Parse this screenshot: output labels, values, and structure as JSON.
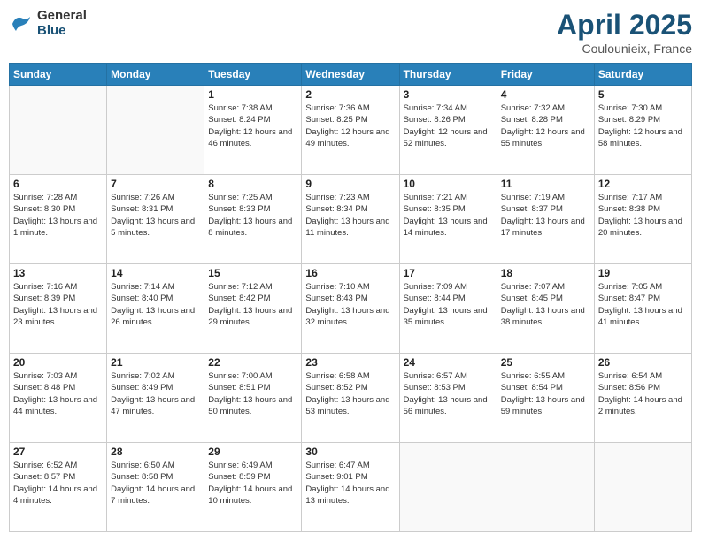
{
  "header": {
    "logo_general": "General",
    "logo_blue": "Blue",
    "title": "April 2025",
    "location": "Coulounieix, France"
  },
  "days_of_week": [
    "Sunday",
    "Monday",
    "Tuesday",
    "Wednesday",
    "Thursday",
    "Friday",
    "Saturday"
  ],
  "weeks": [
    [
      {
        "num": "",
        "info": ""
      },
      {
        "num": "",
        "info": ""
      },
      {
        "num": "1",
        "info": "Sunrise: 7:38 AM\nSunset: 8:24 PM\nDaylight: 12 hours and 46 minutes."
      },
      {
        "num": "2",
        "info": "Sunrise: 7:36 AM\nSunset: 8:25 PM\nDaylight: 12 hours and 49 minutes."
      },
      {
        "num": "3",
        "info": "Sunrise: 7:34 AM\nSunset: 8:26 PM\nDaylight: 12 hours and 52 minutes."
      },
      {
        "num": "4",
        "info": "Sunrise: 7:32 AM\nSunset: 8:28 PM\nDaylight: 12 hours and 55 minutes."
      },
      {
        "num": "5",
        "info": "Sunrise: 7:30 AM\nSunset: 8:29 PM\nDaylight: 12 hours and 58 minutes."
      }
    ],
    [
      {
        "num": "6",
        "info": "Sunrise: 7:28 AM\nSunset: 8:30 PM\nDaylight: 13 hours and 1 minute."
      },
      {
        "num": "7",
        "info": "Sunrise: 7:26 AM\nSunset: 8:31 PM\nDaylight: 13 hours and 5 minutes."
      },
      {
        "num": "8",
        "info": "Sunrise: 7:25 AM\nSunset: 8:33 PM\nDaylight: 13 hours and 8 minutes."
      },
      {
        "num": "9",
        "info": "Sunrise: 7:23 AM\nSunset: 8:34 PM\nDaylight: 13 hours and 11 minutes."
      },
      {
        "num": "10",
        "info": "Sunrise: 7:21 AM\nSunset: 8:35 PM\nDaylight: 13 hours and 14 minutes."
      },
      {
        "num": "11",
        "info": "Sunrise: 7:19 AM\nSunset: 8:37 PM\nDaylight: 13 hours and 17 minutes."
      },
      {
        "num": "12",
        "info": "Sunrise: 7:17 AM\nSunset: 8:38 PM\nDaylight: 13 hours and 20 minutes."
      }
    ],
    [
      {
        "num": "13",
        "info": "Sunrise: 7:16 AM\nSunset: 8:39 PM\nDaylight: 13 hours and 23 minutes."
      },
      {
        "num": "14",
        "info": "Sunrise: 7:14 AM\nSunset: 8:40 PM\nDaylight: 13 hours and 26 minutes."
      },
      {
        "num": "15",
        "info": "Sunrise: 7:12 AM\nSunset: 8:42 PM\nDaylight: 13 hours and 29 minutes."
      },
      {
        "num": "16",
        "info": "Sunrise: 7:10 AM\nSunset: 8:43 PM\nDaylight: 13 hours and 32 minutes."
      },
      {
        "num": "17",
        "info": "Sunrise: 7:09 AM\nSunset: 8:44 PM\nDaylight: 13 hours and 35 minutes."
      },
      {
        "num": "18",
        "info": "Sunrise: 7:07 AM\nSunset: 8:45 PM\nDaylight: 13 hours and 38 minutes."
      },
      {
        "num": "19",
        "info": "Sunrise: 7:05 AM\nSunset: 8:47 PM\nDaylight: 13 hours and 41 minutes."
      }
    ],
    [
      {
        "num": "20",
        "info": "Sunrise: 7:03 AM\nSunset: 8:48 PM\nDaylight: 13 hours and 44 minutes."
      },
      {
        "num": "21",
        "info": "Sunrise: 7:02 AM\nSunset: 8:49 PM\nDaylight: 13 hours and 47 minutes."
      },
      {
        "num": "22",
        "info": "Sunrise: 7:00 AM\nSunset: 8:51 PM\nDaylight: 13 hours and 50 minutes."
      },
      {
        "num": "23",
        "info": "Sunrise: 6:58 AM\nSunset: 8:52 PM\nDaylight: 13 hours and 53 minutes."
      },
      {
        "num": "24",
        "info": "Sunrise: 6:57 AM\nSunset: 8:53 PM\nDaylight: 13 hours and 56 minutes."
      },
      {
        "num": "25",
        "info": "Sunrise: 6:55 AM\nSunset: 8:54 PM\nDaylight: 13 hours and 59 minutes."
      },
      {
        "num": "26",
        "info": "Sunrise: 6:54 AM\nSunset: 8:56 PM\nDaylight: 14 hours and 2 minutes."
      }
    ],
    [
      {
        "num": "27",
        "info": "Sunrise: 6:52 AM\nSunset: 8:57 PM\nDaylight: 14 hours and 4 minutes."
      },
      {
        "num": "28",
        "info": "Sunrise: 6:50 AM\nSunset: 8:58 PM\nDaylight: 14 hours and 7 minutes."
      },
      {
        "num": "29",
        "info": "Sunrise: 6:49 AM\nSunset: 8:59 PM\nDaylight: 14 hours and 10 minutes."
      },
      {
        "num": "30",
        "info": "Sunrise: 6:47 AM\nSunset: 9:01 PM\nDaylight: 14 hours and 13 minutes."
      },
      {
        "num": "",
        "info": ""
      },
      {
        "num": "",
        "info": ""
      },
      {
        "num": "",
        "info": ""
      }
    ]
  ]
}
